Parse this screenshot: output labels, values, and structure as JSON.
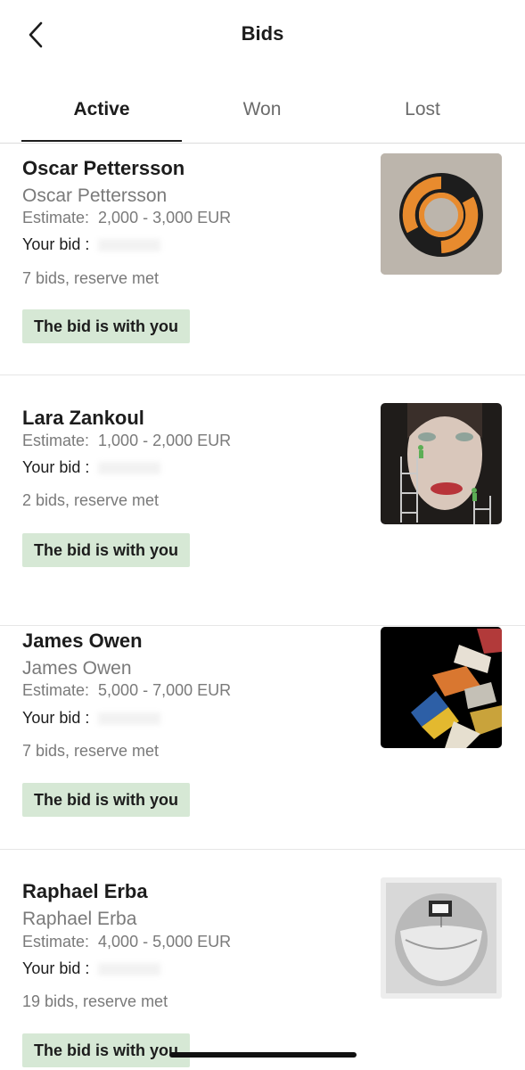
{
  "header": {
    "title": "Bids",
    "back_icon": "chevron-left-icon"
  },
  "tabs": [
    {
      "label": "Active",
      "active": true
    },
    {
      "label": "Won",
      "active": false
    },
    {
      "label": "Lost",
      "active": false
    }
  ],
  "lots": [
    {
      "artist": "Oscar Pettersson",
      "subtitle": "Oscar Pettersson",
      "estimate_label": "Estimate:",
      "estimate_value": "2,000 - 3,000 EUR",
      "your_bid_label": "Your bid :",
      "bids_info": "7 bids, reserve met",
      "status": "The bid is with you"
    },
    {
      "artist": "Lara Zankoul",
      "subtitle": "",
      "estimate_label": "Estimate:",
      "estimate_value": "1,000 - 2,000 EUR",
      "your_bid_label": "Your bid :",
      "bids_info": "2 bids, reserve met",
      "status": "The bid is with you"
    },
    {
      "artist": "James Owen",
      "subtitle": "James Owen",
      "estimate_label": "Estimate:",
      "estimate_value": "5,000 - 7,000 EUR",
      "your_bid_label": "Your bid :",
      "bids_info": "7 bids, reserve met",
      "status": "The bid is with you"
    },
    {
      "artist": "Raphael Erba",
      "subtitle": "Raphael Erba",
      "estimate_label": "Estimate:",
      "estimate_value": "4,000 - 5,000 EUR",
      "your_bid_label": "Your bid :",
      "bids_info": "19 bids, reserve met",
      "status": "The bid is with you"
    }
  ],
  "colors": {
    "status_badge_bg": "#d6e8d5",
    "text_primary": "#1c1c1c",
    "text_secondary": "#7a7a7a"
  }
}
